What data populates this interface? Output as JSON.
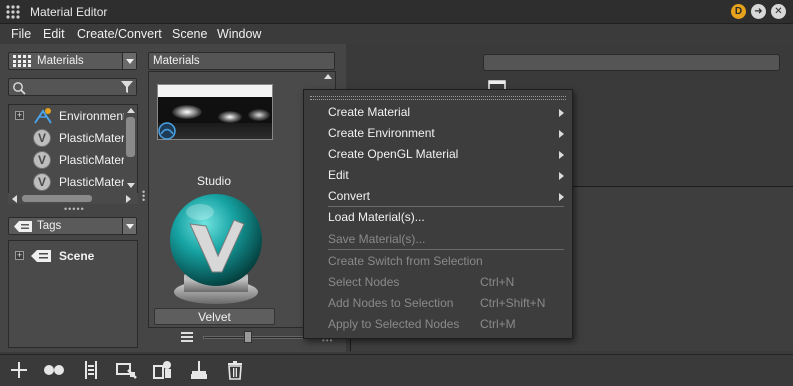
{
  "window": {
    "title": "Material Editor",
    "badge": "D"
  },
  "menubar": {
    "items": [
      "File",
      "Edit",
      "Create/Convert",
      "Scene",
      "Window"
    ]
  },
  "left_top": {
    "dropdown_label": "Materials"
  },
  "materials_tree": {
    "items": [
      {
        "label": "Environment",
        "icon": "environment-icon"
      },
      {
        "label": "PlasticMater",
        "icon": "material-v-icon"
      },
      {
        "label": "PlasticMater",
        "icon": "material-v-icon"
      },
      {
        "label": "PlasticMater",
        "icon": "material-v-icon"
      }
    ]
  },
  "left_bottom": {
    "dropdown_label": "Tags",
    "tree_root": "Scene"
  },
  "center": {
    "header": "Materials",
    "preview_env_label": "Studio",
    "material_name": "Velvet"
  },
  "context_menu": {
    "items": [
      {
        "label": "Create Material",
        "submenu": true,
        "enabled": true
      },
      {
        "label": "Create Environment",
        "submenu": true,
        "enabled": true
      },
      {
        "label": "Create OpenGL Material",
        "submenu": true,
        "enabled": true
      },
      {
        "label": "Edit",
        "submenu": true,
        "enabled": true
      },
      {
        "label": "Convert",
        "submenu": true,
        "enabled": true
      },
      {
        "label": "Load Material(s)...",
        "enabled": true
      },
      {
        "label": "Save Material(s)...",
        "enabled": false
      },
      {
        "label": "Create Switch from Selection",
        "enabled": false
      },
      {
        "label": "Select Nodes",
        "shortcut": "Ctrl+N",
        "enabled": false
      },
      {
        "label": "Add Nodes to Selection",
        "shortcut": "Ctrl+Shift+N",
        "enabled": false
      },
      {
        "label": "Apply to Selected Nodes",
        "shortcut": "Ctrl+M",
        "enabled": false
      }
    ]
  },
  "colors": {
    "accent_teal": "#16a3a3",
    "badge_orange": "#e6a21c",
    "bg": "#3a3a3a"
  }
}
